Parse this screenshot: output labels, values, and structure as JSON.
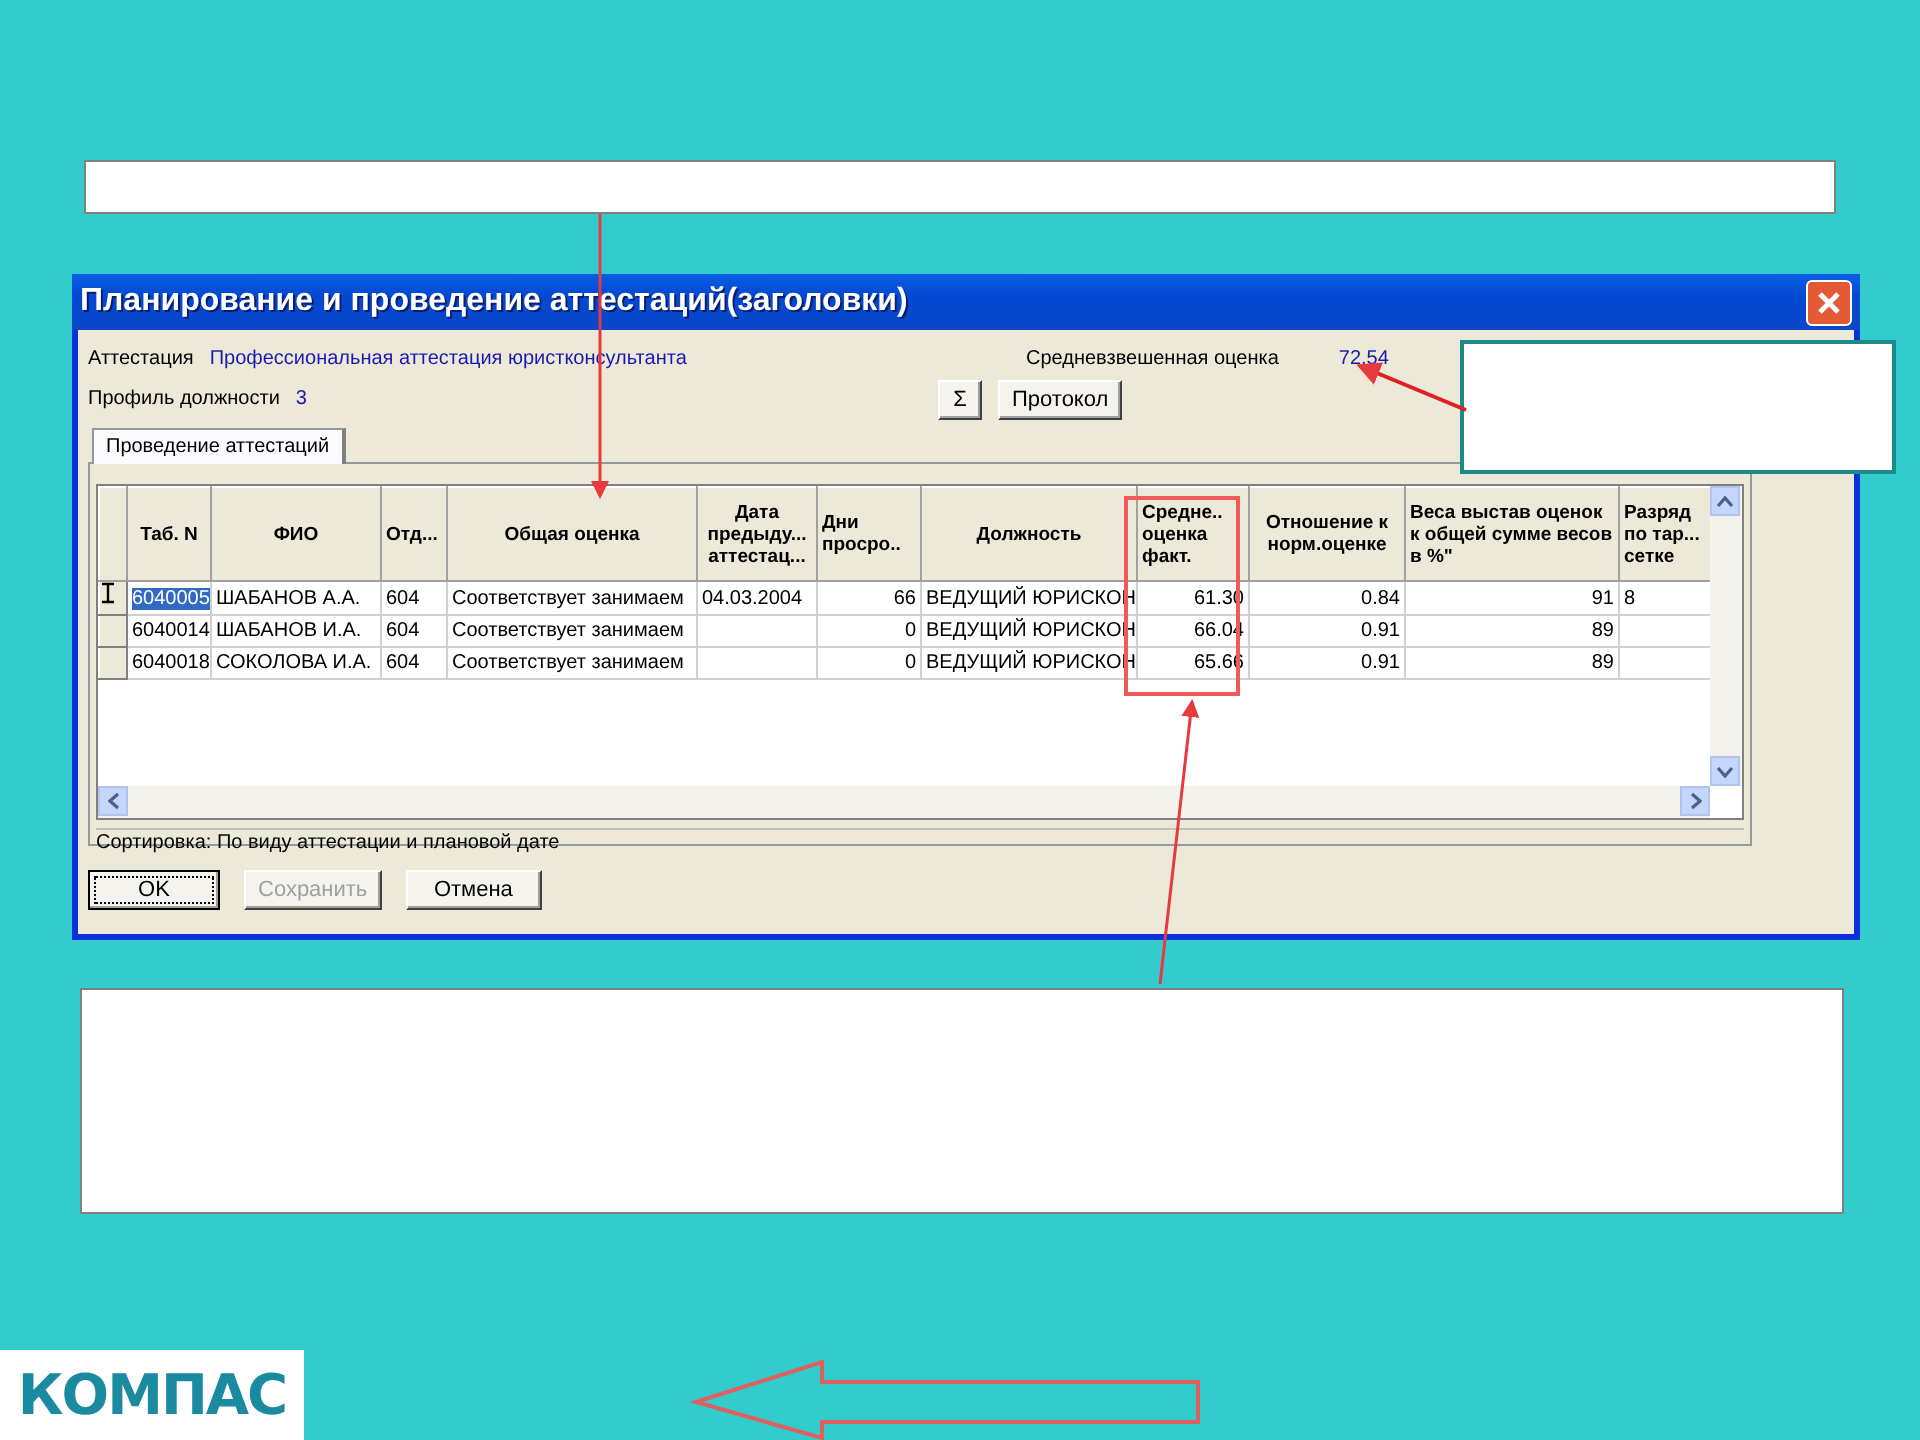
{
  "window": {
    "title": "Планирование и проведение аттестаций(заголовки)"
  },
  "fields": [
    {
      "label": "Аттестация",
      "value": "Профессиональная аттестация юристконсультанта"
    },
    {
      "label": "Профиль должности",
      "value": "3"
    }
  ],
  "weighted_score": {
    "label": "Средневзвешенная оценка",
    "value": "72.54"
  },
  "toolbar_buttons": [
    "Σ",
    "Протокол"
  ],
  "tabs": [
    {
      "label": "Проведение аттестаций",
      "selected": true
    }
  ],
  "table": {
    "columns": [
      {
        "label": "Таб. N",
        "kind": "text"
      },
      {
        "label": "ФИО",
        "kind": "text"
      },
      {
        "label": "Отд...",
        "kind": "text"
      },
      {
        "label": "Общая оценка",
        "kind": "text"
      },
      {
        "label": "Дата предыду... аттестац...",
        "kind": "text"
      },
      {
        "label": "Дни просро..",
        "kind": "number"
      },
      {
        "label": "Должность",
        "kind": "text"
      },
      {
        "label": "Средне.. оценка факт.",
        "kind": "number"
      },
      {
        "label": "Отношение к норм.оценке",
        "kind": "number"
      },
      {
        "label": "Веса выстав оценок к общей сумме весов в %\"",
        "kind": "number"
      },
      {
        "label": "Разряд по тар... сетке",
        "kind": "text"
      }
    ],
    "rows": [
      {
        "selected": true,
        "cells": [
          "6040005",
          "ШАБАНОВ А.А.",
          "604",
          "Соответствует занимаем",
          "04.03.2004",
          "66",
          "ВЕДУЩИЙ ЮРИСКОН",
          "61.30",
          "0.84",
          "91",
          "8"
        ]
      },
      {
        "selected": false,
        "cells": [
          "6040014",
          "ШАБАНОВ И.А.",
          "604",
          "Соответствует занимаем",
          "",
          "0",
          "ВЕДУЩИЙ ЮРИСКОН",
          "66.04",
          "0.91",
          "89",
          ""
        ]
      },
      {
        "selected": false,
        "cells": [
          "6040018",
          "СОКОЛОВА И.А.",
          "604",
          "Соответствует занимаем",
          "",
          "0",
          "ВЕДУЩИЙ ЮРИСКОН",
          "65.66",
          "0.91",
          "89",
          ""
        ]
      }
    ]
  },
  "status": "Сортировка: По виду аттестации и плановой дате",
  "buttons": [
    {
      "label": "OK",
      "default": true,
      "disabled": false
    },
    {
      "label": "Сохранить",
      "default": false,
      "disabled": true
    },
    {
      "label": "Отмена",
      "default": false,
      "disabled": false
    }
  ],
  "logo": {
    "text": "КОМПАС"
  }
}
